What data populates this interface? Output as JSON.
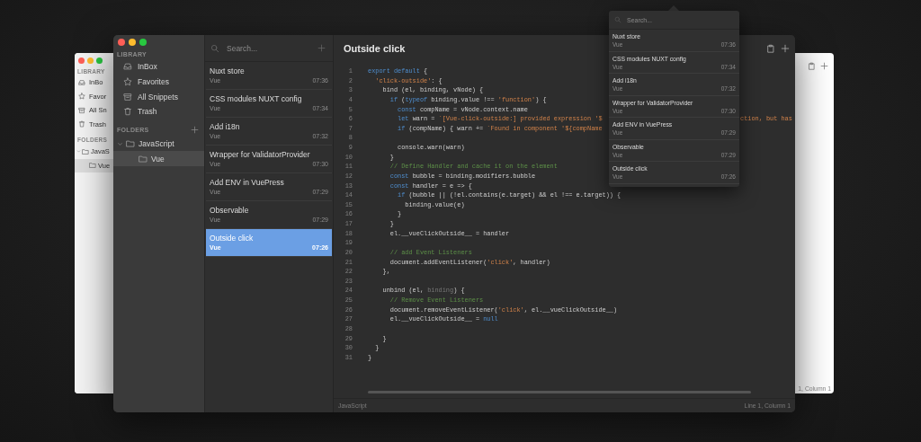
{
  "back_window": {
    "sidebar": {
      "library_label": "LIBRARY",
      "items": [
        {
          "label": "InBo",
          "kind": "inbox",
          "selected": false
        },
        {
          "label": "Favor",
          "kind": "star",
          "selected": false
        },
        {
          "label": "All Sn",
          "kind": "archive",
          "selected": false
        },
        {
          "label": "Trash",
          "kind": "trash",
          "selected": false
        }
      ],
      "folders_label": "FOLDERS",
      "folders": [
        {
          "label": "JavaS",
          "expanded": true,
          "selected": false,
          "children": [
            {
              "label": "Vue",
              "selected": true
            }
          ]
        }
      ]
    },
    "status_text": "1, Column 1"
  },
  "main_window": {
    "sidebar": {
      "library_label": "LIBRARY",
      "items": [
        {
          "label": "InBox",
          "kind": "inbox",
          "selected": false
        },
        {
          "label": "Favorites",
          "kind": "star",
          "selected": false
        },
        {
          "label": "All Snippets",
          "kind": "archive",
          "selected": false
        },
        {
          "label": "Trash",
          "kind": "trash",
          "selected": false
        }
      ],
      "folders_label": "FOLDERS",
      "folders": [
        {
          "label": "JavaScript",
          "expanded": true,
          "selected": false,
          "children": [
            {
              "label": "Vue",
              "selected": true
            }
          ]
        }
      ]
    },
    "search": {
      "placeholder": "Search..."
    },
    "snippets": [
      {
        "title": "Nuxt store",
        "folder": "Vue",
        "time": "07:36",
        "selected": false
      },
      {
        "title": "CSS modules NUXT config",
        "folder": "Vue",
        "time": "07:34",
        "selected": false
      },
      {
        "title": "Add i18n",
        "folder": "Vue",
        "time": "07:32",
        "selected": false
      },
      {
        "title": "Wrapper for ValidatorProvider",
        "folder": "Vue",
        "time": "07:30",
        "selected": false
      },
      {
        "title": "Add ENV in VuePress",
        "folder": "Vue",
        "time": "07:29",
        "selected": false
      },
      {
        "title": "Observable",
        "folder": "Vue",
        "time": "07:29",
        "selected": false
      },
      {
        "title": "Outside click",
        "folder": "Vue",
        "time": "07:26",
        "selected": true
      }
    ],
    "editor": {
      "title": "Outside click",
      "language": "JavaScript",
      "cursor": "Line 1, Column 1",
      "lines": [
        {
          "number": "1",
          "tokens": [
            {
              "kind": "kw",
              "text": "export default"
            },
            {
              "kind": "txt",
              "text": " {"
            }
          ]
        },
        {
          "number": "2",
          "tokens": [
            {
              "kind": "str",
              "text": "  'click-outside'"
            },
            {
              "kind": "txt",
              "text": ": {"
            }
          ]
        },
        {
          "number": "3",
          "tokens": [
            {
              "kind": "txt",
              "text": "    bind (el, binding, vNode) {"
            }
          ]
        },
        {
          "number": "4",
          "tokens": [
            {
              "kind": "kw",
              "text": "      if"
            },
            {
              "kind": "txt",
              "text": " ("
            },
            {
              "kind": "kw",
              "text": "typeof"
            },
            {
              "kind": "txt",
              "text": " binding.value !== "
            },
            {
              "kind": "str",
              "text": "'function'"
            },
            {
              "kind": "txt",
              "text": ") {"
            }
          ]
        },
        {
          "number": "5",
          "tokens": [
            {
              "kind": "kw",
              "text": "        const"
            },
            {
              "kind": "txt",
              "text": " compName = vNode.context.name"
            }
          ]
        },
        {
          "number": "6",
          "tokens": [
            {
              "kind": "kw",
              "text": "        let"
            },
            {
              "kind": "txt",
              "text": " warn = "
            },
            {
              "kind": "str",
              "text": "`[Vue-click-outside:] provided expression '$"
            }
          ],
          "right": [
            {
              "kind": "str",
              "text": "ction, but has"
            }
          ]
        },
        {
          "number": "7",
          "tokens": [
            {
              "kind": "kw",
              "text": "        if"
            },
            {
              "kind": "txt",
              "text": " (compName) { warn += "
            },
            {
              "kind": "str",
              "text": "`Found in component '${compName"
            }
          ]
        },
        {
          "number": "8"
        },
        {
          "number": "9",
          "tokens": [
            {
              "kind": "txt",
              "text": "        console.warn(warn)"
            }
          ]
        },
        {
          "number": "10",
          "tokens": [
            {
              "kind": "txt",
              "text": "      }"
            }
          ]
        },
        {
          "number": "11",
          "tokens": [
            {
              "kind": "cmt",
              "text": "      // Define Handler and cache it on the element"
            }
          ]
        },
        {
          "number": "12",
          "tokens": [
            {
              "kind": "kw",
              "text": "      const"
            },
            {
              "kind": "txt",
              "text": " bubble = binding.modifiers.bubble"
            }
          ]
        },
        {
          "number": "13",
          "tokens": [
            {
              "kind": "kw",
              "text": "      const"
            },
            {
              "kind": "txt",
              "text": " handler = e => {"
            }
          ]
        },
        {
          "number": "14",
          "tokens": [
            {
              "kind": "kw",
              "text": "        if"
            },
            {
              "kind": "txt",
              "text": " (bubble || (!el.contains(e.target) && el !== e.target)) {"
            }
          ]
        },
        {
          "number": "15",
          "tokens": [
            {
              "kind": "txt",
              "text": "          binding.value(e)"
            }
          ]
        },
        {
          "number": "16",
          "tokens": [
            {
              "kind": "txt",
              "text": "        }"
            }
          ]
        },
        {
          "number": "17",
          "tokens": [
            {
              "kind": "txt",
              "text": "      }"
            }
          ]
        },
        {
          "number": "18",
          "tokens": [
            {
              "kind": "txt",
              "text": "      el.__vueClickOutside__ = handler"
            }
          ]
        },
        {
          "number": "19"
        },
        {
          "number": "20",
          "tokens": [
            {
              "kind": "cmt",
              "text": "      // add Event Listeners"
            }
          ]
        },
        {
          "number": "21",
          "tokens": [
            {
              "kind": "txt",
              "text": "      document.addEventListener("
            },
            {
              "kind": "str",
              "text": "'click'"
            },
            {
              "kind": "txt",
              "text": ", handler)"
            }
          ]
        },
        {
          "number": "22",
          "tokens": [
            {
              "kind": "txt",
              "text": "    },"
            }
          ]
        },
        {
          "number": "23"
        },
        {
          "number": "24",
          "tokens": [
            {
              "kind": "txt",
              "text": "    unbind (el, "
            },
            {
              "kind": "dim",
              "text": "binding"
            },
            {
              "kind": "txt",
              "text": ") {"
            }
          ]
        },
        {
          "number": "25",
          "tokens": [
            {
              "kind": "cmt",
              "text": "      // Remove Event Listeners"
            }
          ]
        },
        {
          "number": "26",
          "tokens": [
            {
              "kind": "txt",
              "text": "      document.removeEventListener("
            },
            {
              "kind": "str",
              "text": "'click'"
            },
            {
              "kind": "txt",
              "text": ", el.__vueClickOutside__)"
            }
          ]
        },
        {
          "number": "27",
          "tokens": [
            {
              "kind": "txt",
              "text": "      el.__vueClickOutside__ = "
            },
            {
              "kind": "kw",
              "text": "null"
            }
          ]
        },
        {
          "number": "28"
        },
        {
          "number": "29",
          "tokens": [
            {
              "kind": "txt",
              "text": "    }"
            }
          ]
        },
        {
          "number": "30",
          "tokens": [
            {
              "kind": "txt",
              "text": "  }"
            }
          ]
        },
        {
          "number": "31",
          "tokens": [
            {
              "kind": "txt",
              "text": "}"
            }
          ]
        }
      ]
    }
  },
  "popup": {
    "search": {
      "placeholder": "Search..."
    },
    "items": [
      {
        "title": "Nuxt store",
        "folder": "Vue",
        "time": "07:36"
      },
      {
        "title": "CSS modules NUXT config",
        "folder": "Vue",
        "time": "07:34"
      },
      {
        "title": "Add i18n",
        "folder": "Vue",
        "time": "07:32"
      },
      {
        "title": "Wrapper for ValidatorProvider",
        "folder": "Vue",
        "time": "07:30"
      },
      {
        "title": "Add ENV in VuePress",
        "folder": "Vue",
        "time": "07:29"
      },
      {
        "title": "Observable",
        "folder": "Vue",
        "time": "07:29"
      },
      {
        "title": "Outside click",
        "folder": "Vue",
        "time": "07:26"
      }
    ]
  }
}
